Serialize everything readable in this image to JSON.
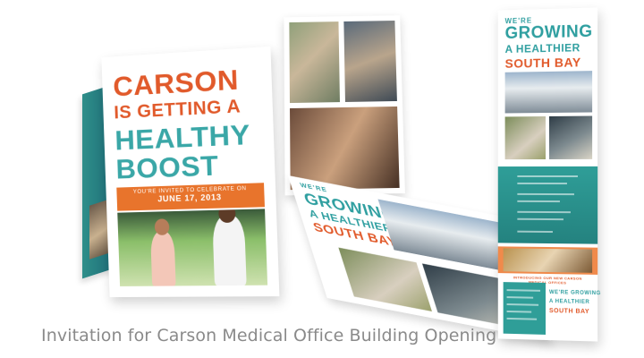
{
  "tent_card": {
    "line1": "CARSON",
    "line2": "IS GETTING A",
    "line3": "HEALTHY",
    "line4": "BOOST",
    "invite": "YOU'RE INVITED TO CELEBRATE ON",
    "date": "JUNE 17, 2013"
  },
  "fold_panel": {
    "we": "WE'RE",
    "growing": "GROWING",
    "healthier": "A HEALTHIER",
    "south_bay": "SOUTH BAY"
  },
  "tall_panel": {
    "we": "WE'RE",
    "growing": "GROWING",
    "healthier": "A HEALTHIER",
    "south_bay": "SOUTH BAY",
    "intro": "INTRODUCING OUR NEW CARSON MEDICAL OFFICES",
    "footer_we": "WE'RE GROWING",
    "footer_healthier": "A HEALTHIER",
    "footer_south_bay": "SOUTH BAY"
  },
  "colors": {
    "orange": "#e15a2b",
    "teal": "#3aa7a7",
    "band": "#e8742c",
    "caption": "#8a8a8a"
  },
  "caption": "Invitation for Carson Medical Office Building Opening"
}
